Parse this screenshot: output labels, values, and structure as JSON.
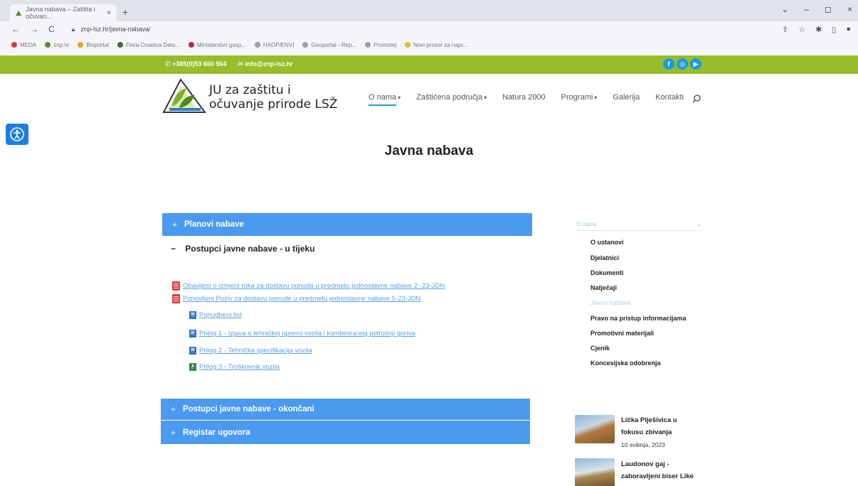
{
  "browser": {
    "tab_title": "Javna nabava – Zaštita i očuvan…",
    "tab_close": "×",
    "new_tab": "+",
    "url": "znp-lsz.hr/javna-nabava/",
    "win_controls": [
      "⌄",
      "–",
      "◻",
      "×"
    ],
    "bookmarks": [
      {
        "label": "MEDA",
        "color": "#d83b2f"
      },
      {
        "label": "znp.hr",
        "color": "#5b8c2a"
      },
      {
        "label": "Bioportal",
        "color": "#e8a51f"
      },
      {
        "label": "Flora Croatica Data...",
        "color": "#3a6e3a"
      },
      {
        "label": "Ministarstvo gosp...",
        "color": "#c3252b"
      },
      {
        "label": "HAOP/ENVI",
        "color": "#9aa0a6"
      },
      {
        "label": "Geoportal - Rep...",
        "color": "#9aa0a6"
      },
      {
        "label": "Promotej",
        "color": "#9aa0a6"
      },
      {
        "label": "Novi prozor za napr...",
        "color": "#e3c019"
      }
    ]
  },
  "topbar": {
    "phone": "+385(0)53 660 564",
    "email": "info@znp-lsz.hr",
    "social": [
      "f",
      "◎",
      "▶"
    ]
  },
  "header": {
    "logo_line1": "JU za zaštitu i",
    "logo_line2": "očuvanje prirode LSŽ",
    "nav": [
      {
        "label": "O nama",
        "caret": "▾",
        "active": true
      },
      {
        "label": "Zaštićena područja",
        "caret": "▾",
        "active": false
      },
      {
        "label": "Natura 2000",
        "caret": "",
        "active": false
      },
      {
        "label": "Programi",
        "caret": "▾",
        "active": false
      },
      {
        "label": "Galerija",
        "caret": "",
        "active": false
      },
      {
        "label": "Kontakti",
        "caret": "",
        "active": false
      }
    ]
  },
  "page": {
    "title": "Javna nabava"
  },
  "accordion": {
    "section1": {
      "sign": "+",
      "label": "Planovi nabave"
    },
    "section2": {
      "sign": "−",
      "label": "Postupci javne nabave - u tijeku"
    },
    "section3": {
      "sign": "+",
      "label": "Postupci javne nabave - okončani"
    },
    "section4": {
      "sign": "+",
      "label": "Registar ugovora"
    }
  },
  "documents": [
    {
      "label": "Obavijest o izmjeni roka za dostavu ponuda u predmetu jednostavne nabave 2 -23-JDN",
      "icon": "pdf"
    },
    {
      "label": "Ponovljeni Poziv za dostavu ponude u predmetu jednostavne nabave 5-23-JDN",
      "icon": "pdf"
    },
    {
      "label": "Ponudbeni list",
      "icon": "doc"
    },
    {
      "label": "Prilog 1 - Izjava o tehničkoj opremi vozila i kombiniranog potrošnji goriva",
      "icon": "doc"
    },
    {
      "label": "Prilog 2 - Tehnička specifikacija vozila",
      "icon": "doc"
    },
    {
      "label": "Prilog 3 - Troškovnik vozila",
      "icon": "xls"
    }
  ],
  "sidebar": {
    "heading": "O nama",
    "chevron": "⌄",
    "items": [
      {
        "label": "O ustanovi",
        "muted": false
      },
      {
        "label": "Djelatnici",
        "muted": false
      },
      {
        "label": "Dokumenti",
        "muted": false
      },
      {
        "label": "Natječaji",
        "muted": false
      },
      {
        "label": "Javna nabava",
        "muted": true
      },
      {
        "label": "Pravo na pristup informacijama",
        "muted": false
      },
      {
        "label": "Promotivni materijali",
        "muted": false
      },
      {
        "label": "Cjenik",
        "muted": false
      },
      {
        "label": "Koncesijska odobrenja",
        "muted": false
      }
    ]
  },
  "news": [
    {
      "title": "Lička Plješivica u fokusu zbivanja",
      "date": "10 svibnja, 2023"
    },
    {
      "title": "Laudonov gaj - zaboravljeni biser Like",
      "date": ""
    }
  ],
  "colors": {
    "topbar_green": "#97bd2c",
    "accordion_blue": "#4a9af0",
    "link_blue": "#5a9fe8",
    "access_blue": "#1f7ee0"
  }
}
